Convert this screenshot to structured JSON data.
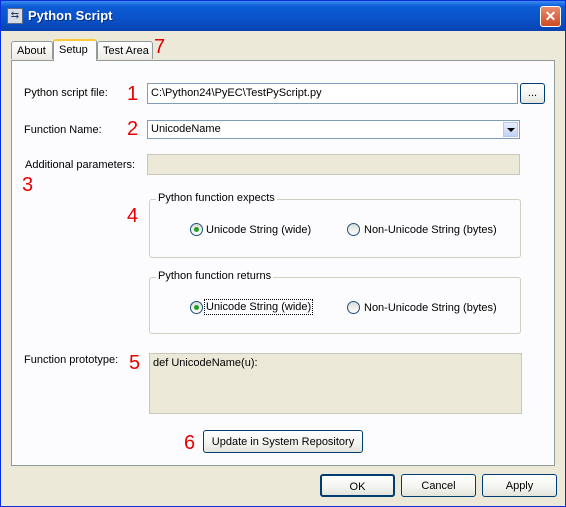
{
  "window": {
    "title": "Python Script",
    "close_glyph": "✕"
  },
  "tabs": [
    {
      "label": "About",
      "active": false
    },
    {
      "label": "Setup",
      "active": true
    },
    {
      "label": "Test Area",
      "active": false
    }
  ],
  "setup": {
    "script_file_label": "Python script file:",
    "script_file_value": "C:\\Python24\\PyEC\\TestPyScript.py",
    "browse_label": "...",
    "function_name_label": "Function Name:",
    "function_name_value": "UnicodeName",
    "additional_params_label": "Additional parameters:",
    "additional_params_value": "",
    "expects": {
      "title": "Python function expects",
      "option1": "Unicode String (wide)",
      "option2": "Non-Unicode String (bytes)",
      "selected": 1
    },
    "returns": {
      "title": "Python function returns",
      "option1": "Unicode String (wide)",
      "option2": "Non-Unicode String (bytes)",
      "selected": 1
    },
    "prototype_label": "Function prototype:",
    "prototype_value": "def UnicodeName(u):",
    "update_button": "Update in System Repository"
  },
  "annotations": [
    "1",
    "2",
    "3",
    "4",
    "5",
    "6",
    "7"
  ],
  "footer": {
    "ok": "OK",
    "cancel": "Cancel",
    "apply": "Apply"
  },
  "colors": {
    "annotation": "#e60000",
    "titlebar": "#0a52c8",
    "radio_selected": "#21a121"
  }
}
